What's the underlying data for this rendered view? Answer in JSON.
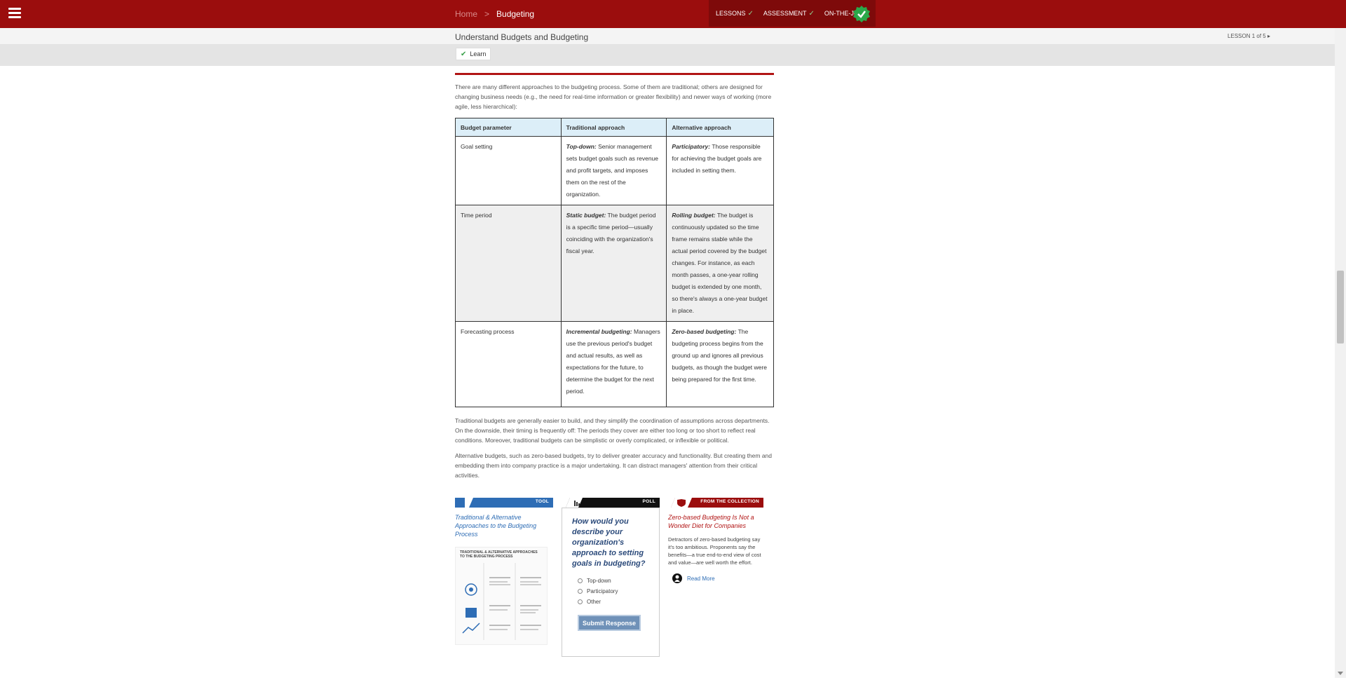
{
  "topbar": {
    "breadcrumb_home": "Home",
    "breadcrumb_separator": ">",
    "breadcrumb_current": "Budgeting",
    "steps": [
      "LESSONS",
      "ASSESSMENT",
      "ON-THE-JOB"
    ],
    "accent_color": "#9b0d0d"
  },
  "subheader": {
    "title": "Understand Budgets and Budgeting",
    "lesson_nav": "LESSON 1 of 5"
  },
  "tabs": {
    "learn": "Learn"
  },
  "main": {
    "intro": "There are many different approaches to the budgeting process. Some of them are traditional; others are designed for changing business needs (e.g., the need for real-time information or greater flexibility) and newer ways of working (more agile, less hierarchical):",
    "table": {
      "headers": [
        "Budget parameter",
        "Traditional approach",
        "Alternative approach"
      ],
      "rows": [
        {
          "param": "Goal setting",
          "trad_term": "Top-down:",
          "trad_text": " Senior management sets budget goals such as revenue and profit targets, and imposes them on the rest of the organization.",
          "alt_term": "Participatory:",
          "alt_text": " Those responsible for achieving the budget goals are included in setting them."
        },
        {
          "param": "Time period",
          "trad_term": "Static budget:",
          "trad_text": " The budget period is a specific time period—usually coinciding with the organization's fiscal year.",
          "alt_term": "Rolling budget:",
          "alt_text": " The budget is continuously updated so the time frame remains stable while the actual period covered by the budget changes. For instance, as each month passes, a one-year rolling budget is extended by one month, so there's always a one-year budget in place."
        },
        {
          "param": "Forecasting process",
          "trad_term": "Incremental budgeting:",
          "trad_text": " Managers use the previous period's budget and actual results, as well as expectations for the future, to determine the budget for the next period.",
          "alt_term": "Zero-based budgeting:",
          "alt_text": " The budgeting process begins from the ground up and ignores all previous budgets, as though the budget were being prepared for the first time."
        }
      ]
    },
    "para2": "Traditional budgets are generally easier to build, and they simplify the coordination of assumptions across departments. On the downside, their timing is frequently off: The periods they cover are either too long or too short to reflect real conditions. Moreover, traditional budgets can be simplistic or overly complicated, or inflexible or political.",
    "para3": "Alternative budgets, such as zero-based budgets, try to deliver greater accuracy and functionality. But creating them and embedding them into company practice is a major undertaking. It can distract managers' attention from their critical activities."
  },
  "cards": {
    "tool": {
      "label": "TOOL",
      "title": "Traditional & Alternative Approaches to the Budgeting Process",
      "thumb_title": "TRADITIONAL & ALTERNATIVE APPROACHES TO THE BUDGETING PROCESS"
    },
    "poll": {
      "label": "POLL",
      "question": "How would you describe your organization's approach to setting goals in budgeting?",
      "options": [
        "Top-down",
        "Participatory",
        "Other"
      ],
      "submit": "Submit Response"
    },
    "collection": {
      "label": "FROM THE COLLECTION",
      "title": "Zero-based Budgeting Is Not a Wonder Diet for Companies",
      "description": "Detractors of zero-based budgeting say it's too ambitious. Proponents say the benefits—a true end-to-end view of cost and value—are well worth the effort.",
      "read_more": "Read More"
    }
  }
}
